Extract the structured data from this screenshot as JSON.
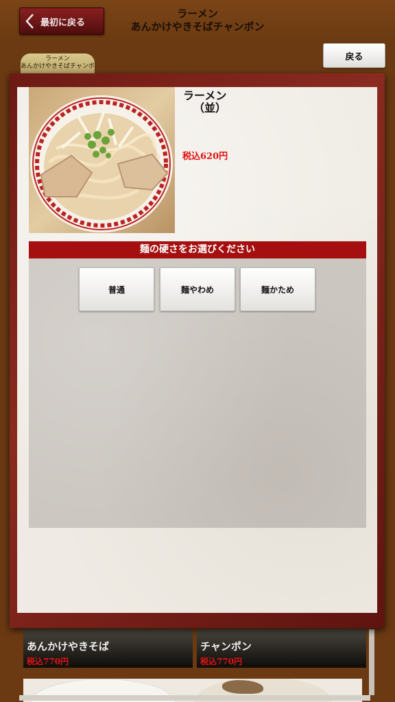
{
  "header": {
    "back_to_start_label": "最初に戻る",
    "title_line1": "ラーメン",
    "title_line2": "あんかけやきそばチャンポン",
    "back_label": "戻る"
  },
  "category_tab": {
    "line1": "ラーメン",
    "line2": "あんかけやきそばチャンポン"
  },
  "background_items": [
    {
      "name": "あんかけやきそば",
      "price": "税込770円"
    },
    {
      "name": "チャンポン",
      "price": "税込770円"
    }
  ],
  "modal": {
    "dish_name_line1": "ラーメン",
    "dish_name_line2": "（並）",
    "price": "税込620円",
    "option_title": "麺の硬さをお選びください",
    "options": [
      {
        "label": "普通"
      },
      {
        "label": "麺やわめ"
      },
      {
        "label": "麺かため"
      }
    ]
  },
  "colors": {
    "accent_red": "#a50f0f",
    "price_red": "#e01010",
    "frame": "#6b3a12"
  },
  "icons": {
    "back_chevron": "chevron-left-icon"
  }
}
